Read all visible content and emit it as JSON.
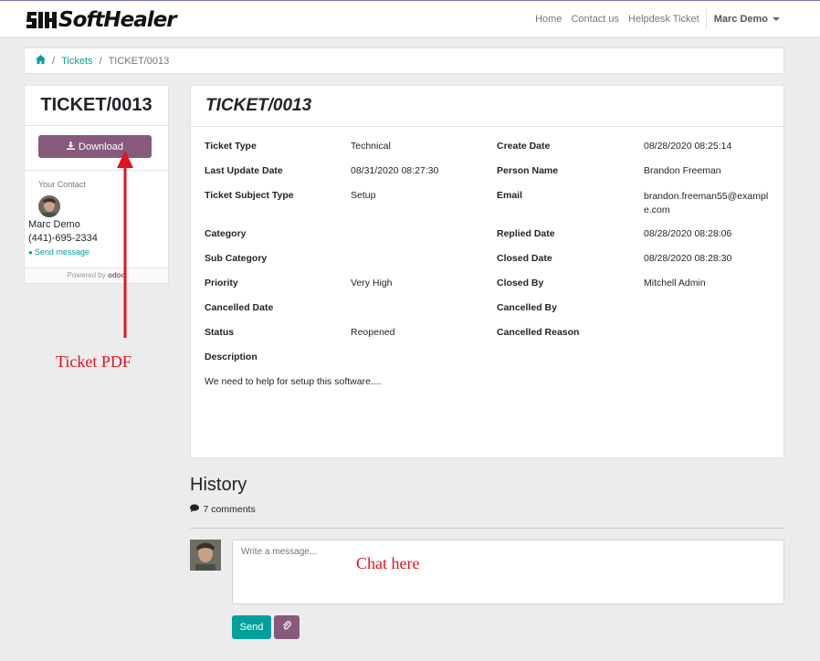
{
  "header": {
    "logo_text": "SoftHealer",
    "nav": [
      "Home",
      "Contact us",
      "Helpdesk Ticket"
    ],
    "user": "Marc Demo"
  },
  "breadcrumb": {
    "home_icon": "home-icon",
    "items": [
      "Tickets",
      "TICKET/0013"
    ]
  },
  "sidebar": {
    "title": "TICKET/0013",
    "download_label": "Download",
    "download_icon": "download-icon",
    "contact_label": "Your Contact",
    "contact_name": "Marc Demo",
    "contact_phone": "(441)-695-2334",
    "send_message": "Send message",
    "powered_by": "Powered by",
    "powered_brand": "odoo"
  },
  "ticket": {
    "title": "TICKET/0013",
    "fields": [
      {
        "label": "Ticket Type",
        "value": "Technical"
      },
      {
        "label": "Create Date",
        "value": "08/28/2020 08:25:14"
      },
      {
        "label": "Last Update Date",
        "value": "08/31/2020 08:27:30"
      },
      {
        "label": "Person Name",
        "value": "Brandon Freeman"
      },
      {
        "label": "Ticket Subject Type",
        "value": "Setup"
      },
      {
        "label": "Email",
        "value": "brandon.freeman55@example.com"
      },
      {
        "label": "Category",
        "value": ""
      },
      {
        "label": "Replied Date",
        "value": "08/28/2020 08:28:06"
      },
      {
        "label": "Sub Category",
        "value": ""
      },
      {
        "label": "Closed Date",
        "value": "08/28/2020 08:28:30"
      },
      {
        "label": "Priority",
        "value": "Very High"
      },
      {
        "label": "Closed By",
        "value": "Mitchell Admin"
      },
      {
        "label": "Cancelled Date",
        "value": ""
      },
      {
        "label": "Cancelled By",
        "value": ""
      },
      {
        "label": "Status",
        "value": "Reopened"
      },
      {
        "label": "Cancelled Reason",
        "value": ""
      }
    ],
    "description_label": "Description",
    "description": "We need to help for setup this software...."
  },
  "history": {
    "title": "History",
    "comments": "7 comments",
    "message_placeholder": "Write a message...",
    "send_label": "Send",
    "attach_icon": "paperclip-icon"
  },
  "annotations": {
    "ticket_pdf": "Ticket PDF",
    "chat_here": "Chat here",
    "color": "#e0141e"
  },
  "colors": {
    "primary": "#875a7b",
    "accent": "#00a09d"
  }
}
